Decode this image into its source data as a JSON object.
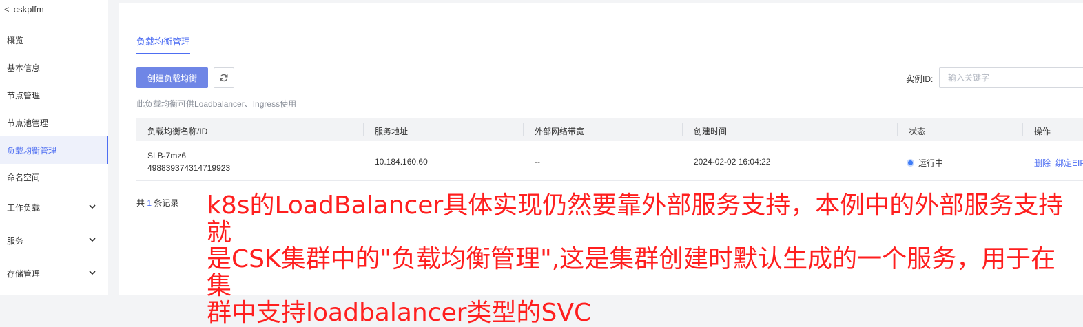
{
  "sidebar": {
    "cluster_name": "cskplfm",
    "items": [
      {
        "label": "概览"
      },
      {
        "label": "基本信息"
      },
      {
        "label": "节点管理"
      },
      {
        "label": "节点池管理"
      },
      {
        "label": "负载均衡管理",
        "active": true
      },
      {
        "label": "命名空间"
      },
      {
        "label": "工作负载",
        "expandable": true
      },
      {
        "label": "服务",
        "expandable": true
      },
      {
        "label": "存储管理",
        "expandable": true
      }
    ]
  },
  "main": {
    "tab_label": "负载均衡管理",
    "create_button": "创建负载均衡",
    "hint": "此负载均衡可供Loadbalancer、Ingress使用",
    "search": {
      "label": "实例ID:",
      "placeholder": "输入关键字"
    },
    "table": {
      "headers": [
        "负载均衡名称/ID",
        "服务地址",
        "外部网络带宽",
        "创建时间",
        "状态",
        "操作"
      ],
      "rows": [
        {
          "name": "SLB-7mz6",
          "id": "498839374314719923",
          "address": "10.184.160.60",
          "bandwidth": "--",
          "created": "2024-02-02 16:04:22",
          "status": "运行中",
          "actions": [
            "删除",
            "绑定EIP"
          ]
        }
      ]
    },
    "total": {
      "prefix": "共",
      "count": "1",
      "suffix": "条记录"
    }
  },
  "annotation": {
    "lines": [
      "k8s的LoadBalancer具体实现仍然要靠外部服务支持，本例中的外部服务支持就",
      "是CSK集群中的\"负载均衡管理\",这是集群创建时默认生成的一个服务，用于在集",
      "群中支持loadbalancer类型的SVC"
    ]
  },
  "colors": {
    "accent": "#4e6ef2",
    "button": "#6f86e6",
    "annotation": "#ff1f1f",
    "status_running": "#3f7cf7"
  }
}
